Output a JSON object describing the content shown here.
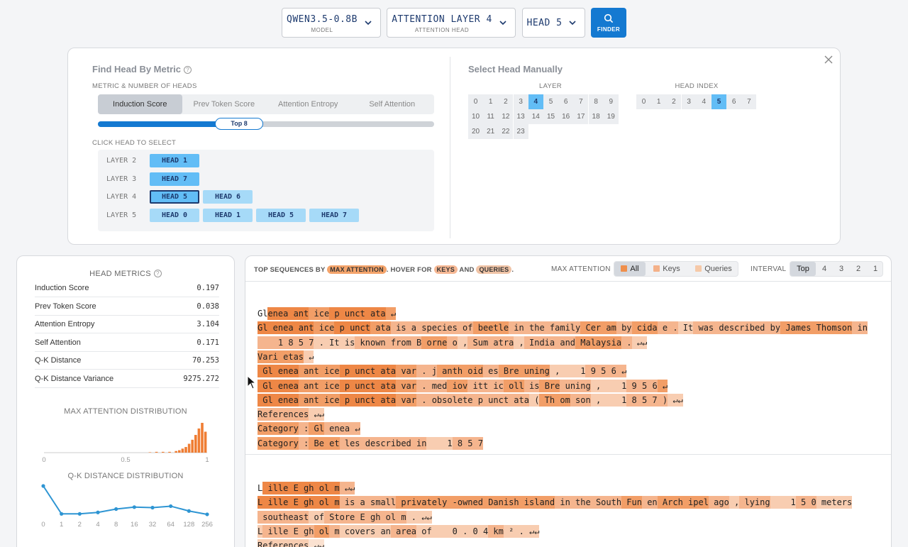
{
  "topbar": {
    "model": {
      "value": "QWEN3.5-0.8B",
      "caption": "MODEL"
    },
    "layer": {
      "value": "ATTENTION LAYER 4",
      "caption": "ATTENTION HEAD"
    },
    "head": {
      "value": "HEAD 5"
    },
    "finder_label": "FINDER"
  },
  "finder": {
    "left_title": "Find Head By Metric",
    "metric_caption": "METRIC & NUMBER OF HEADS",
    "tabs": [
      "Induction Score",
      "Prev Token Score",
      "Attention Entropy",
      "Self Attention"
    ],
    "active_tab": "Induction Score",
    "topk_label": "Top 8",
    "topk_fraction": 0.42,
    "click_caption": "CLICK HEAD TO SELECT",
    "rows": [
      {
        "layer": "LAYER 2",
        "heads": [
          {
            "label": "HEAD 1",
            "level": "hi"
          }
        ]
      },
      {
        "layer": "LAYER 3",
        "heads": [
          {
            "label": "HEAD 7",
            "level": "hi"
          }
        ]
      },
      {
        "layer": "LAYER 4",
        "heads": [
          {
            "label": "HEAD 5",
            "level": "hi",
            "selected": true
          },
          {
            "label": "HEAD 6",
            "level": "mid"
          }
        ]
      },
      {
        "layer": "LAYER 5",
        "heads": [
          {
            "label": "HEAD 0",
            "level": "mid"
          },
          {
            "label": "HEAD 1",
            "level": "mid"
          },
          {
            "label": "HEAD 5",
            "level": "mid"
          },
          {
            "label": "HEAD 7",
            "level": "mid"
          }
        ]
      }
    ],
    "right_title": "Select Head Manually",
    "layer_caption": "LAYER",
    "head_caption": "HEAD INDEX",
    "layers": [
      "0",
      "1",
      "2",
      "3",
      "4",
      "5",
      "6",
      "7",
      "8",
      "9",
      "10",
      "11",
      "12",
      "13",
      "14",
      "15",
      "16",
      "17",
      "18",
      "19",
      "20",
      "21",
      "22",
      "23"
    ],
    "selected_layer": "4",
    "head_indices": [
      "0",
      "1",
      "2",
      "3",
      "4",
      "5",
      "6",
      "7"
    ],
    "selected_head": "5"
  },
  "metrics": {
    "title": "HEAD METRICS",
    "rows": [
      {
        "k": "Induction Score",
        "v": "0.197"
      },
      {
        "k": "Prev Token Score",
        "v": "0.038"
      },
      {
        "k": "Attention Entropy",
        "v": "3.104"
      },
      {
        "k": "Self Attention",
        "v": "0.171"
      },
      {
        "k": "Q-K Distance",
        "v": "70.253"
      },
      {
        "k": "Q-K Distance Variance",
        "v": "9275.272"
      }
    ]
  },
  "chart_data": [
    {
      "type": "bar",
      "title": "MAX ATTENTION DISTRIBUTION",
      "xlim": [
        0,
        1
      ],
      "xticks": [
        "0",
        "0.5",
        "1"
      ],
      "x": [
        0.66,
        0.7,
        0.74,
        0.78,
        0.82,
        0.84,
        0.86,
        0.88,
        0.9,
        0.92,
        0.94,
        0.96,
        0.98,
        1.0
      ],
      "values": [
        0.5,
        1,
        1,
        1,
        2,
        3,
        5,
        7,
        11,
        16,
        22,
        30,
        37,
        26
      ],
      "color": "#ef7d33"
    },
    {
      "type": "line",
      "title": "Q-K DISTANCE DISTRIBUTION",
      "categories": [
        "0",
        "1",
        "2",
        "4",
        "8",
        "16",
        "32",
        "64",
        "128",
        "256"
      ],
      "values": [
        62,
        4,
        4,
        7,
        14,
        18,
        17,
        20,
        10,
        3
      ],
      "color": "#2e95d3"
    }
  ],
  "sequences": {
    "hint_prefix": "TOP SEQUENCES BY",
    "hint_max": "MAX ATTENTION",
    "hint_mid": ". HOVER FOR",
    "hint_keys": "KEYS",
    "hint_and": "AND",
    "hint_queries": "QUERIES",
    "hint_end": ".",
    "max_attention_label": "MAX ATTENTION",
    "mode_buttons": [
      "All",
      "Keys",
      "Queries"
    ],
    "active_mode": "All",
    "interval_label": "INTERVAL",
    "interval_buttons": [
      "Top",
      "4",
      "3",
      "2",
      "1"
    ],
    "active_interval": "Top",
    "blocks": [
      {
        "lines": [
          [
            [
              "Gl",
              ""
            ],
            [
              "enea",
              "t1"
            ],
            [
              " ant",
              "t1"
            ],
            [
              " ice",
              "t2"
            ],
            [
              " p",
              "t1"
            ],
            [
              " unct",
              "t1"
            ],
            [
              " ata",
              "t1"
            ],
            [
              " ↵",
              "t2"
            ]
          ],
          [
            [
              "Gl",
              "t1"
            ],
            [
              " enea",
              "t1"
            ],
            [
              " ant",
              "t1"
            ],
            [
              " ice",
              "t2"
            ],
            [
              " p",
              "t1"
            ],
            [
              " unct",
              "t1"
            ],
            [
              " ata",
              "t2"
            ],
            [
              " is",
              "t3"
            ],
            [
              " a",
              "t3"
            ],
            [
              " species",
              "t3"
            ],
            [
              " of",
              "t3"
            ],
            [
              " beetle",
              "t2"
            ],
            [
              " in",
              "t3"
            ],
            [
              " the",
              "t3"
            ],
            [
              " family",
              "t3"
            ],
            [
              " Cer",
              "t2"
            ],
            [
              " am",
              "t2"
            ],
            [
              " by",
              "t3"
            ],
            [
              " cida",
              "t2"
            ],
            [
              " e",
              "t3"
            ],
            [
              " .",
              "t3"
            ],
            [
              " It",
              "t4"
            ],
            [
              " was",
              "t3"
            ],
            [
              " described",
              "t3"
            ],
            [
              " by",
              "t3"
            ],
            [
              " James",
              "t2"
            ],
            [
              " Thomson",
              "t2"
            ],
            [
              " in",
              "t3"
            ]
          ],
          [
            [
              "    1",
              "t3"
            ],
            [
              " 8",
              "t3"
            ],
            [
              " 5",
              "t3"
            ],
            [
              " 7",
              "t3"
            ],
            [
              " .",
              "t4"
            ],
            [
              " It",
              "t4"
            ],
            [
              " is",
              "t4"
            ],
            [
              " known",
              "t3"
            ],
            [
              " from",
              "t3"
            ],
            [
              " B",
              "t3"
            ],
            [
              " orne",
              "t2"
            ],
            [
              " o",
              "t3"
            ],
            [
              " ,",
              "t4"
            ],
            [
              " Sum",
              "t3"
            ],
            [
              " atra",
              "t3"
            ],
            [
              " ,",
              "t4"
            ],
            [
              " India",
              "t3"
            ],
            [
              " and",
              "t3"
            ],
            [
              " Malaysia",
              "t2"
            ],
            [
              " .",
              "t3"
            ],
            [
              " ↵↵",
              "t4"
            ]
          ],
          [
            [
              "Vari",
              "t2"
            ],
            [
              " etas",
              "t2"
            ],
            [
              " ↵",
              "t4"
            ]
          ],
          [
            [
              " Gl",
              "t1"
            ],
            [
              " enea",
              "t1"
            ],
            [
              " ant",
              "t2"
            ],
            [
              " ice",
              "t2"
            ],
            [
              " p",
              "t1"
            ],
            [
              " unct",
              "t1"
            ],
            [
              " ata",
              "t1"
            ],
            [
              " var",
              "t2"
            ],
            [
              " .",
              "t3"
            ],
            [
              " j",
              "t3"
            ],
            [
              " anth",
              "t2"
            ],
            [
              " oid",
              "t2"
            ],
            [
              " es",
              "t3"
            ],
            [
              " Bre",
              "t2"
            ],
            [
              " uning",
              "t2"
            ],
            [
              " ,",
              "t4"
            ],
            [
              "    1",
              "t4"
            ],
            [
              " 9",
              "t3"
            ],
            [
              " 5",
              "t3"
            ],
            [
              " 6",
              "t3"
            ],
            [
              " ↵",
              "t3"
            ]
          ],
          [
            [
              " Gl",
              "t1"
            ],
            [
              " enea",
              "t1"
            ],
            [
              " ant",
              "t2"
            ],
            [
              " ice",
              "t2"
            ],
            [
              " p",
              "t1"
            ],
            [
              " unct",
              "t1"
            ],
            [
              " ata",
              "t1"
            ],
            [
              " var",
              "t2"
            ],
            [
              " .",
              "t3"
            ],
            [
              " med",
              "t3"
            ],
            [
              " iov",
              "t2"
            ],
            [
              " itt",
              "t3"
            ],
            [
              " ic",
              "t3"
            ],
            [
              " oll",
              "t2"
            ],
            [
              " is",
              "t3"
            ],
            [
              " Bre",
              "t2"
            ],
            [
              " uning",
              "t3"
            ],
            [
              " ,",
              "t4"
            ],
            [
              "    1",
              "t4"
            ],
            [
              " 9",
              "t3"
            ],
            [
              " 5",
              "t3"
            ],
            [
              " 6",
              "t3"
            ],
            [
              " ↵",
              "t2"
            ]
          ],
          [
            [
              " Gl",
              "t1"
            ],
            [
              " enea",
              "t1"
            ],
            [
              " ant",
              "t2"
            ],
            [
              " ice",
              "t2"
            ],
            [
              " p",
              "t1"
            ],
            [
              " unct",
              "t1"
            ],
            [
              " ata",
              "t1"
            ],
            [
              " var",
              "t2"
            ],
            [
              " .",
              "t3"
            ],
            [
              " obsolete",
              "t3"
            ],
            [
              " p",
              "t3"
            ],
            [
              " unct",
              "t3"
            ],
            [
              " ata",
              "t3"
            ],
            [
              " (",
              "t4"
            ],
            [
              " Th",
              "t2"
            ],
            [
              " om",
              "t2"
            ],
            [
              " son",
              "t3"
            ],
            [
              " ,",
              "t4"
            ],
            [
              "    1",
              "t4"
            ],
            [
              " 8",
              "t3"
            ],
            [
              " 5",
              "t3"
            ],
            [
              " 7",
              "t3"
            ],
            [
              " )",
              "t3"
            ],
            [
              " ↵↵",
              "t4"
            ]
          ],
          [
            [
              "References",
              "t3"
            ],
            [
              " ↵↵",
              "t4"
            ]
          ],
          [
            [
              "Category",
              "t2"
            ],
            [
              " :",
              "t3"
            ],
            [
              " Gl",
              "t2"
            ],
            [
              " enea",
              "t3"
            ],
            [
              " ↵",
              "t3"
            ]
          ],
          [
            [
              "Category",
              "t2"
            ],
            [
              " :",
              "t3"
            ],
            [
              " Be",
              "t2"
            ],
            [
              " et",
              "t2"
            ],
            [
              " les",
              "t3"
            ],
            [
              " described",
              "t3"
            ],
            [
              " in",
              "t3"
            ],
            [
              "    1",
              "t4"
            ],
            [
              " 8",
              "t3"
            ],
            [
              " 5",
              "t3"
            ],
            [
              " 7",
              "t3"
            ]
          ]
        ]
      },
      {
        "lines": [
          [
            [
              "L",
              ""
            ],
            [
              " ille",
              "t1"
            ],
            [
              " E",
              "t1"
            ],
            [
              " gh",
              "t1"
            ],
            [
              " ol",
              "t1"
            ],
            [
              " m",
              "t1"
            ],
            [
              " ↵↵",
              "t3"
            ]
          ],
          [
            [
              "L",
              "t1"
            ],
            [
              " ille",
              "t1"
            ],
            [
              " E",
              "t1"
            ],
            [
              " gh",
              "t1"
            ],
            [
              " ol",
              "t1"
            ],
            [
              " m",
              "t1"
            ],
            [
              " is",
              "t3"
            ],
            [
              " a",
              "t3"
            ],
            [
              " small",
              "t3"
            ],
            [
              " privately",
              "t2"
            ],
            [
              " -owned",
              "t2"
            ],
            [
              " Danish",
              "t2"
            ],
            [
              " island",
              "t2"
            ],
            [
              " in",
              "t3"
            ],
            [
              " the",
              "t3"
            ],
            [
              " South",
              "t3"
            ],
            [
              " Fun",
              "t2"
            ],
            [
              " en",
              "t3"
            ],
            [
              " Arch",
              "t2"
            ],
            [
              " ipel",
              "t2"
            ],
            [
              " ago",
              "t3"
            ],
            [
              " ,",
              "t4"
            ],
            [
              " lying",
              "t3"
            ],
            [
              "    1",
              "t4"
            ],
            [
              " 5",
              "t3"
            ],
            [
              " 0",
              "t3"
            ],
            [
              " meters",
              "t4"
            ]
          ],
          [
            [
              " southeast",
              "t3"
            ],
            [
              " of",
              "t4"
            ],
            [
              " Store",
              "t3"
            ],
            [
              " E",
              "t3"
            ],
            [
              " gh",
              "t3"
            ],
            [
              " ol",
              "t3"
            ],
            [
              " m",
              "t3"
            ],
            [
              " .",
              "t4"
            ],
            [
              " ↵↵",
              "t4"
            ]
          ],
          [
            [
              "L",
              "t4"
            ],
            [
              " ille",
              "t3"
            ],
            [
              " E",
              "t3"
            ],
            [
              " gh",
              "t3"
            ],
            [
              " ol",
              "t2"
            ],
            [
              " m",
              "t3"
            ],
            [
              " covers",
              "t4"
            ],
            [
              " an",
              "t4"
            ],
            [
              " area",
              "t3"
            ],
            [
              " of",
              "t4"
            ],
            [
              "    0",
              "t4"
            ],
            [
              " .",
              "t4"
            ],
            [
              " 0",
              "t4"
            ],
            [
              " 4",
              "t4"
            ],
            [
              " km",
              "t3"
            ],
            [
              " ²",
              "t4"
            ],
            [
              " .",
              "t4"
            ],
            [
              " ↵↵",
              "t4"
            ]
          ],
          [
            [
              "References",
              "t4"
            ],
            [
              " ↵↵",
              "t5"
            ]
          ]
        ]
      }
    ]
  }
}
